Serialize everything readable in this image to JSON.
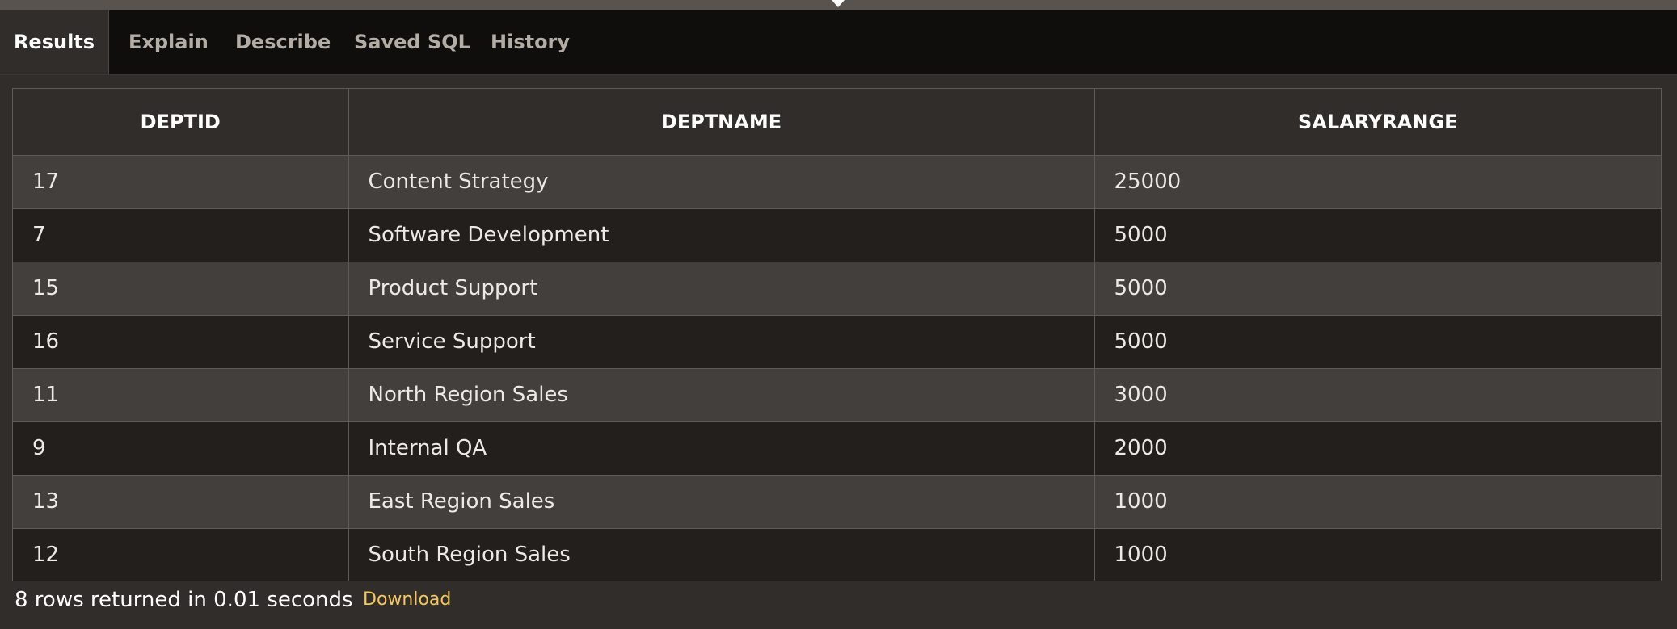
{
  "tabs": [
    {
      "label": "Results",
      "active": true
    },
    {
      "label": "Explain",
      "active": false
    },
    {
      "label": "Describe",
      "active": false
    },
    {
      "label": "Saved SQL",
      "active": false
    },
    {
      "label": "History",
      "active": false
    }
  ],
  "grid": {
    "columns": [
      "DEPTID",
      "DEPTNAME",
      "SALARYRANGE"
    ],
    "rows": [
      [
        "17",
        "Content Strategy",
        "25000"
      ],
      [
        "7",
        "Software Development",
        "5000"
      ],
      [
        "15",
        "Product Support",
        "5000"
      ],
      [
        "16",
        "Service Support",
        "5000"
      ],
      [
        "11",
        "North Region Sales",
        "3000"
      ],
      [
        "9",
        "Internal QA",
        "2000"
      ],
      [
        "13",
        "East Region Sales",
        "1000"
      ],
      [
        "12",
        "South Region Sales",
        "1000"
      ]
    ]
  },
  "footer": {
    "row_count_text": "8 rows returned in 0.01 seconds",
    "download_label": "Download"
  },
  "colors": {
    "background": "#302d2a",
    "tab_bar": "#0f0e0c",
    "row_odd": "#433f3c",
    "row_even": "#221f1c",
    "link": "#f5c85c"
  }
}
